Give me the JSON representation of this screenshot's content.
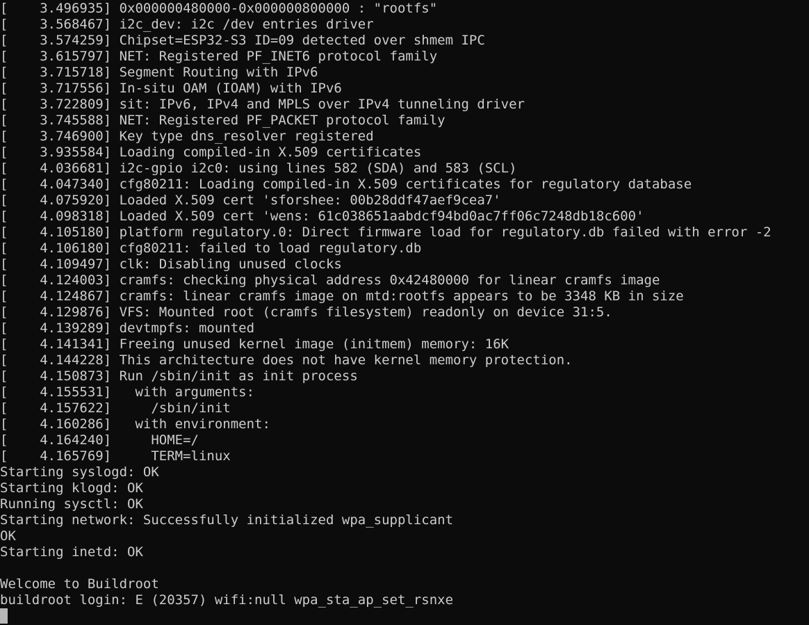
{
  "terminal": {
    "lines": [
      "[    3.496935] 0x000000480000-0x000000800000 : \"rootfs\"",
      "[    3.568467] i2c_dev: i2c /dev entries driver",
      "[    3.574259] Chipset=ESP32-S3 ID=09 detected over shmem IPC",
      "[    3.615797] NET: Registered PF_INET6 protocol family",
      "[    3.715718] Segment Routing with IPv6",
      "[    3.717556] In-situ OAM (IOAM) with IPv6",
      "[    3.722809] sit: IPv6, IPv4 and MPLS over IPv4 tunneling driver",
      "[    3.745588] NET: Registered PF_PACKET protocol family",
      "[    3.746900] Key type dns_resolver registered",
      "[    3.935584] Loading compiled-in X.509 certificates",
      "[    4.036681] i2c-gpio i2c0: using lines 582 (SDA) and 583 (SCL)",
      "[    4.047340] cfg80211: Loading compiled-in X.509 certificates for regulatory database",
      "[    4.075920] Loaded X.509 cert 'sforshee: 00b28ddf47aef9cea7'",
      "[    4.098318] Loaded X.509 cert 'wens: 61c038651aabdcf94bd0ac7ff06c7248db18c600'",
      "[    4.105180] platform regulatory.0: Direct firmware load for regulatory.db failed with error -2",
      "[    4.106180] cfg80211: failed to load regulatory.db",
      "[    4.109497] clk: Disabling unused clocks",
      "[    4.124003] cramfs: checking physical address 0x42480000 for linear cramfs image",
      "[    4.124867] cramfs: linear cramfs image on mtd:rootfs appears to be 3348 KB in size",
      "[    4.129876] VFS: Mounted root (cramfs filesystem) readonly on device 31:5.",
      "[    4.139289] devtmpfs: mounted",
      "[    4.141341] Freeing unused kernel image (initmem) memory: 16K",
      "[    4.144228] This architecture does not have kernel memory protection.",
      "[    4.150873] Run /sbin/init as init process",
      "[    4.155531]   with arguments:",
      "[    4.157622]     /sbin/init",
      "[    4.160286]   with environment:",
      "[    4.164240]     HOME=/",
      "[    4.165769]     TERM=linux",
      "Starting syslogd: OK",
      "Starting klogd: OK",
      "Running sysctl: OK",
      "Starting network: Successfully initialized wpa_supplicant",
      "OK",
      "Starting inetd: OK",
      "",
      "Welcome to Buildroot",
      "buildroot login: E (20357) wifi:null wpa_sta_ap_set_rsnxe"
    ],
    "colors": {
      "background": "#0c0c0c",
      "foreground": "#cccccc",
      "cursor": "#b8b8b8"
    }
  }
}
